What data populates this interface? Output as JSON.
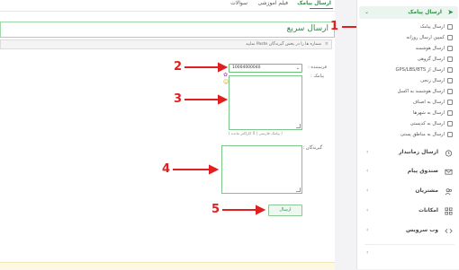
{
  "tabs": [
    {
      "label": "ارسال پیامک",
      "active": true
    },
    {
      "label": "فیلم آموزشی",
      "active": false
    },
    {
      "label": "سوالات",
      "active": false
    }
  ],
  "main": {
    "title": "ارسال سریع",
    "info": "شماره ها را در بخش گیرندگان Paste نمایید",
    "sender_label": "فرستنده :",
    "sender_value": "10004000040",
    "message_label": "پیامک :",
    "char_info": "( پیامک فارسی | 0 کاراکتر مانده )",
    "recipients_label": "گیرندگان :",
    "send_label": "ارسال"
  },
  "sidebar": {
    "header": "ارسال پیامک",
    "items": [
      {
        "label": "ارسال پیامک"
      },
      {
        "label": "کمپین ارسال روزانه"
      },
      {
        "label": "ارسال هوشمند"
      },
      {
        "label": "ارسال گروهی"
      },
      {
        "label": "ارسال از GPS/LBS/BTS"
      },
      {
        "label": "ارسال زنجی"
      },
      {
        "label": "ارسال هوشمند به اکسل"
      },
      {
        "label": "ارسال به اصناف"
      },
      {
        "label": "ارسال به شهرها"
      },
      {
        "label": "ارسال به کدپستی"
      },
      {
        "label": "ارسال به مناطق پستی"
      }
    ],
    "sections": [
      {
        "label": "ارسال زمانبدار"
      },
      {
        "label": "صندوق پیام"
      },
      {
        "label": "مشتریان"
      },
      {
        "label": "امکانات"
      },
      {
        "label": "وب سرویس"
      }
    ]
  },
  "annotations": [
    "1",
    "2",
    "3",
    "4",
    "5"
  ],
  "colors": {
    "accent": "#2f8f46",
    "annotation": "#e02020",
    "highlight": "#e9f5ee"
  }
}
